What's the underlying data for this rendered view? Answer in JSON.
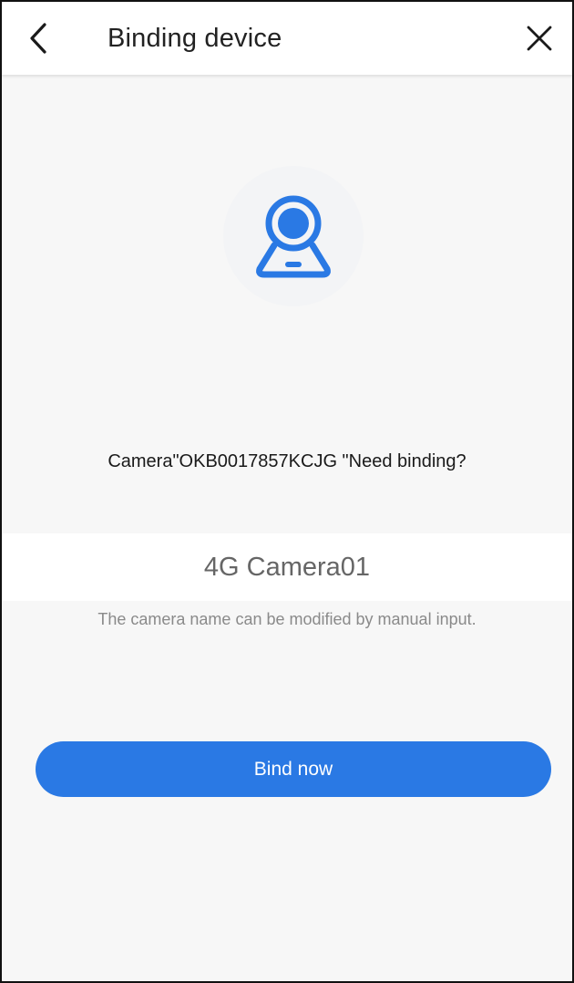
{
  "header": {
    "title": "Binding device",
    "back_icon": "chevron-left-icon",
    "close_icon": "close-icon"
  },
  "device": {
    "icon": "webcam-icon",
    "question": "Camera\"OKB0017857KCJG \"Need binding?"
  },
  "name_field": {
    "value": "4G Camera01",
    "hint": "The camera name can be modified by manual input."
  },
  "actions": {
    "bind_label": "Bind now"
  },
  "colors": {
    "accent": "#2a79e4",
    "background": "#f7f7f7",
    "header_bg": "#ffffff",
    "hint": "#8a8a8a"
  }
}
